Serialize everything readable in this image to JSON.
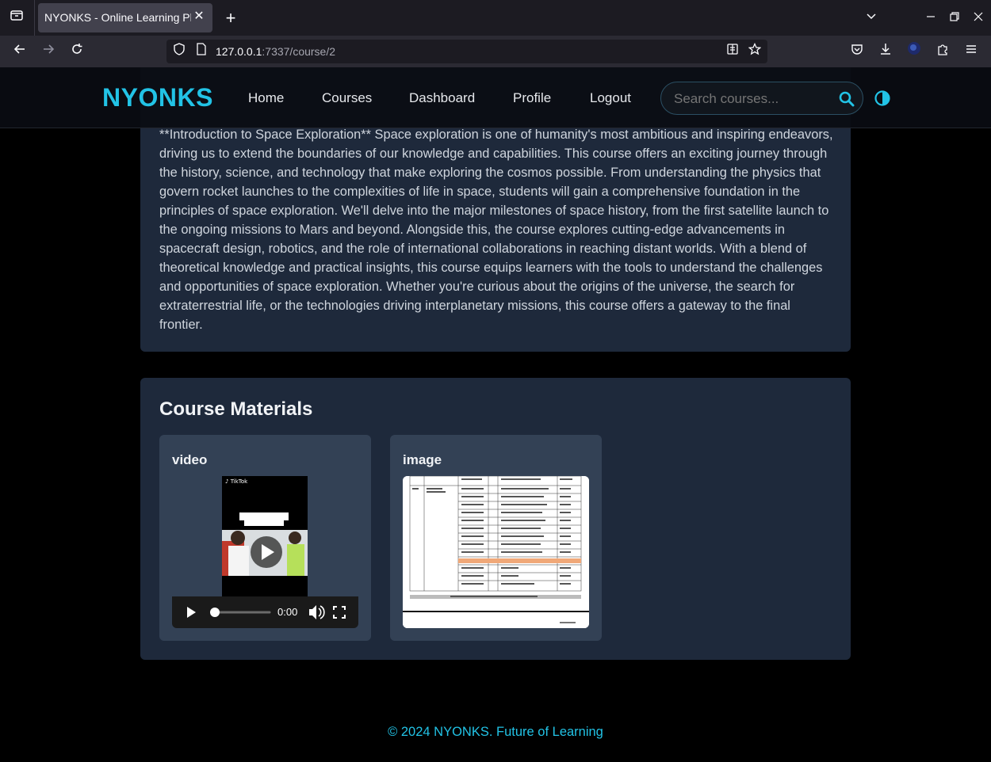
{
  "browser": {
    "tab_title": "NYONKS - Online Learning Platform",
    "url_host": "127.0.0.1",
    "url_rest": ":7337/course/2"
  },
  "site": {
    "logo": "NYONKS",
    "nav": [
      "Home",
      "Courses",
      "Dashboard",
      "Profile",
      "Logout"
    ],
    "search_placeholder": "Search courses..."
  },
  "course": {
    "description": "**Introduction to Space Exploration** Space exploration is one of humanity's most ambitious and inspiring endeavors, driving us to extend the boundaries of our knowledge and capabilities. This course offers an exciting journey through the history, science, and technology that make exploring the cosmos possible. From understanding the physics that govern rocket launches to the complexities of life in space, students will gain a comprehensive foundation in the principles of space exploration. We'll delve into the major milestones of space history, from the first satellite launch to the ongoing missions to Mars and beyond. Alongside this, the course explores cutting-edge advancements in spacecraft design, robotics, and the role of international collaborations in reaching distant worlds. With a blend of theoretical knowledge and practical insights, this course equips learners with the tools to understand the challenges and opportunities of space exploration. Whether you're curious about the origins of the universe, the search for extraterrestrial life, or the technologies driving interplanetary missions, this course offers a gateway to the final frontier."
  },
  "materials": {
    "title": "Course Materials",
    "items": [
      {
        "label": "video",
        "time": "0:00"
      },
      {
        "label": "image"
      }
    ]
  },
  "footer": "© 2024 NYONKS. Future of Learning"
}
